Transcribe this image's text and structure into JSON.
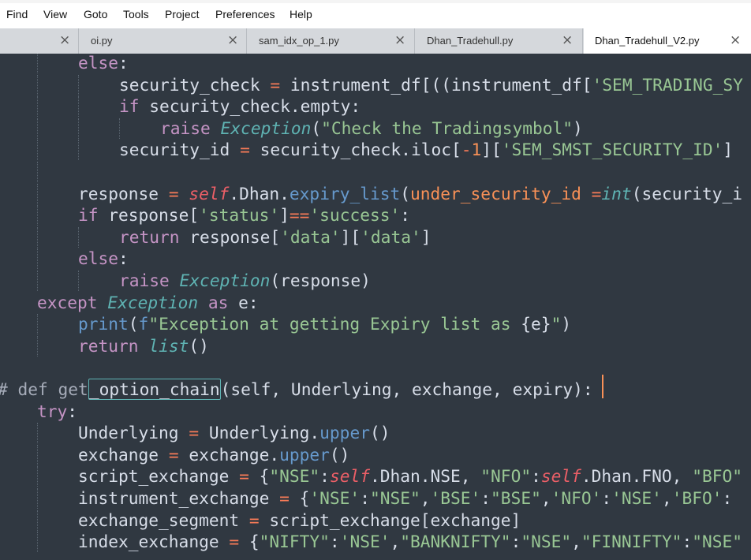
{
  "menu": [
    "Find",
    "View",
    "Goto",
    "Tools",
    "Project",
    "Preferences",
    "Help"
  ],
  "tabs": [
    {
      "label": "",
      "active": false
    },
    {
      "label": "oi.py",
      "active": false
    },
    {
      "label": "sam_idx_op_1.py",
      "active": false
    },
    {
      "label": "Dhan_Tradehull.py",
      "active": false
    },
    {
      "label": "Dhan_Tradehull_V2.py",
      "active": true
    }
  ],
  "tab_close_glyph": "×",
  "colors": {
    "background": "#303841",
    "keyword": "#c594c5",
    "string": "#99c794",
    "class_name": "#5fb3b3",
    "function": "#6699cc",
    "self": "#ec5f67",
    "argument": "#f99157",
    "caret": "#f99157"
  },
  "code_lines": [
    [
      [
        "kw",
        "else"
      ],
      [
        "plain",
        ":"
      ]
    ],
    [
      [
        "plain",
        "security_check "
      ],
      [
        "op",
        "="
      ],
      [
        "plain",
        " instrument_df[((instrument_df["
      ],
      [
        "str",
        "'SEM_TRADING_SY"
      ]
    ],
    [
      [
        "kw",
        "if"
      ],
      [
        "plain",
        " security_check.empty:"
      ]
    ],
    [
      [
        "kw",
        "raise"
      ],
      [
        "plain",
        " "
      ],
      [
        "cls",
        "Exception"
      ],
      [
        "plain",
        "("
      ],
      [
        "str",
        "\"Check the Tradingsymbol\""
      ],
      [
        "plain",
        ")"
      ]
    ],
    [
      [
        "plain",
        "security_id "
      ],
      [
        "op",
        "="
      ],
      [
        "plain",
        " security_check.iloc["
      ],
      [
        "op",
        "-"
      ],
      [
        "num",
        "1"
      ],
      [
        "plain",
        "]["
      ],
      [
        "str",
        "'SEM_SMST_SECURITY_ID'"
      ],
      [
        "plain",
        "]"
      ]
    ],
    [],
    [
      [
        "plain",
        "response "
      ],
      [
        "op",
        "="
      ],
      [
        "plain",
        " "
      ],
      [
        "self",
        "self"
      ],
      [
        "plain",
        ".Dhan."
      ],
      [
        "meth",
        "expiry_list"
      ],
      [
        "plain",
        "("
      ],
      [
        "arg",
        "under_security_id"
      ],
      [
        "plain",
        " "
      ],
      [
        "op",
        "="
      ],
      [
        "cls",
        "int"
      ],
      [
        "plain",
        "(security_i"
      ]
    ],
    [
      [
        "kw",
        "if"
      ],
      [
        "plain",
        " response["
      ],
      [
        "str",
        "'status'"
      ],
      [
        "plain",
        "]"
      ],
      [
        "op",
        "=="
      ],
      [
        "str",
        "'success'"
      ],
      [
        "plain",
        ":"
      ]
    ],
    [
      [
        "kw",
        "return"
      ],
      [
        "plain",
        " response["
      ],
      [
        "str",
        "'data'"
      ],
      [
        "plain",
        "]["
      ],
      [
        "str",
        "'data'"
      ],
      [
        "plain",
        "]"
      ]
    ],
    [
      [
        "kw",
        "else"
      ],
      [
        "plain",
        ":"
      ]
    ],
    [
      [
        "kw",
        "raise"
      ],
      [
        "plain",
        " "
      ],
      [
        "cls",
        "Exception"
      ],
      [
        "plain",
        "(response)"
      ]
    ],
    [
      [
        "kw",
        "except"
      ],
      [
        "plain",
        " "
      ],
      [
        "cls",
        "Exception"
      ],
      [
        "plain",
        " "
      ],
      [
        "kw",
        "as"
      ],
      [
        "plain",
        " e:"
      ]
    ],
    [
      [
        "fn",
        "print"
      ],
      [
        "plain",
        "("
      ],
      [
        "fn",
        "f"
      ],
      [
        "str",
        "\"Exception at getting Expiry list as "
      ],
      [
        "plain",
        "{e}"
      ],
      [
        "str",
        "\""
      ],
      [
        "plain",
        ")"
      ]
    ],
    [
      [
        "kw",
        "return"
      ],
      [
        "plain",
        " "
      ],
      [
        "cls",
        "list"
      ],
      [
        "plain",
        "()"
      ]
    ],
    [],
    [
      [
        "comment",
        "# def get"
      ],
      [
        "hl",
        "_option_chain"
      ],
      [
        "plain",
        "(self, Underlying, exchange, expiry):"
      ]
    ],
    [
      [
        "kw",
        "try"
      ],
      [
        "plain",
        ":"
      ]
    ],
    [
      [
        "plain",
        "Underlying "
      ],
      [
        "op",
        "="
      ],
      [
        "plain",
        " Underlying."
      ],
      [
        "meth",
        "upper"
      ],
      [
        "plain",
        "()"
      ]
    ],
    [
      [
        "plain",
        "exchange "
      ],
      [
        "op",
        "="
      ],
      [
        "plain",
        " exchange."
      ],
      [
        "meth",
        "upper"
      ],
      [
        "plain",
        "()"
      ]
    ],
    [
      [
        "plain",
        "script_exchange "
      ],
      [
        "op",
        "="
      ],
      [
        "plain",
        " {"
      ],
      [
        "str",
        "\"NSE\""
      ],
      [
        "plain",
        ":"
      ],
      [
        "self",
        "self"
      ],
      [
        "plain",
        ".Dhan.NSE, "
      ],
      [
        "str",
        "\"NFO\""
      ],
      [
        "plain",
        ":"
      ],
      [
        "self",
        "self"
      ],
      [
        "plain",
        ".Dhan.FNO, "
      ],
      [
        "str",
        "\"BFO\""
      ]
    ],
    [
      [
        "plain",
        "instrument_exchange "
      ],
      [
        "op",
        "="
      ],
      [
        "plain",
        " {"
      ],
      [
        "str",
        "'NSE'"
      ],
      [
        "plain",
        ":"
      ],
      [
        "str",
        "\"NSE\""
      ],
      [
        "plain",
        ","
      ],
      [
        "str",
        "'BSE'"
      ],
      [
        "plain",
        ":"
      ],
      [
        "str",
        "\"BSE\""
      ],
      [
        "plain",
        ","
      ],
      [
        "str",
        "'NFO'"
      ],
      [
        "plain",
        ":"
      ],
      [
        "str",
        "'NSE'"
      ],
      [
        "plain",
        ","
      ],
      [
        "str",
        "'BFO'"
      ],
      [
        "plain",
        ":"
      ]
    ],
    [
      [
        "plain",
        "exchange_segment "
      ],
      [
        "op",
        "="
      ],
      [
        "plain",
        " script_exchange[exchange]"
      ]
    ],
    [
      [
        "plain",
        "index_exchange "
      ],
      [
        "op",
        "="
      ],
      [
        "plain",
        " {"
      ],
      [
        "str",
        "\"NIFTY\""
      ],
      [
        "plain",
        ":"
      ],
      [
        "str",
        "'NSE'"
      ],
      [
        "plain",
        ","
      ],
      [
        "str",
        "\"BANKNIFTY\""
      ],
      [
        "plain",
        ":"
      ],
      [
        "str",
        "\"NSE\""
      ],
      [
        "plain",
        ","
      ],
      [
        "str",
        "\"FINNIFTY\""
      ],
      [
        "plain",
        ":"
      ],
      [
        "str",
        "\"NSE\""
      ]
    ]
  ]
}
